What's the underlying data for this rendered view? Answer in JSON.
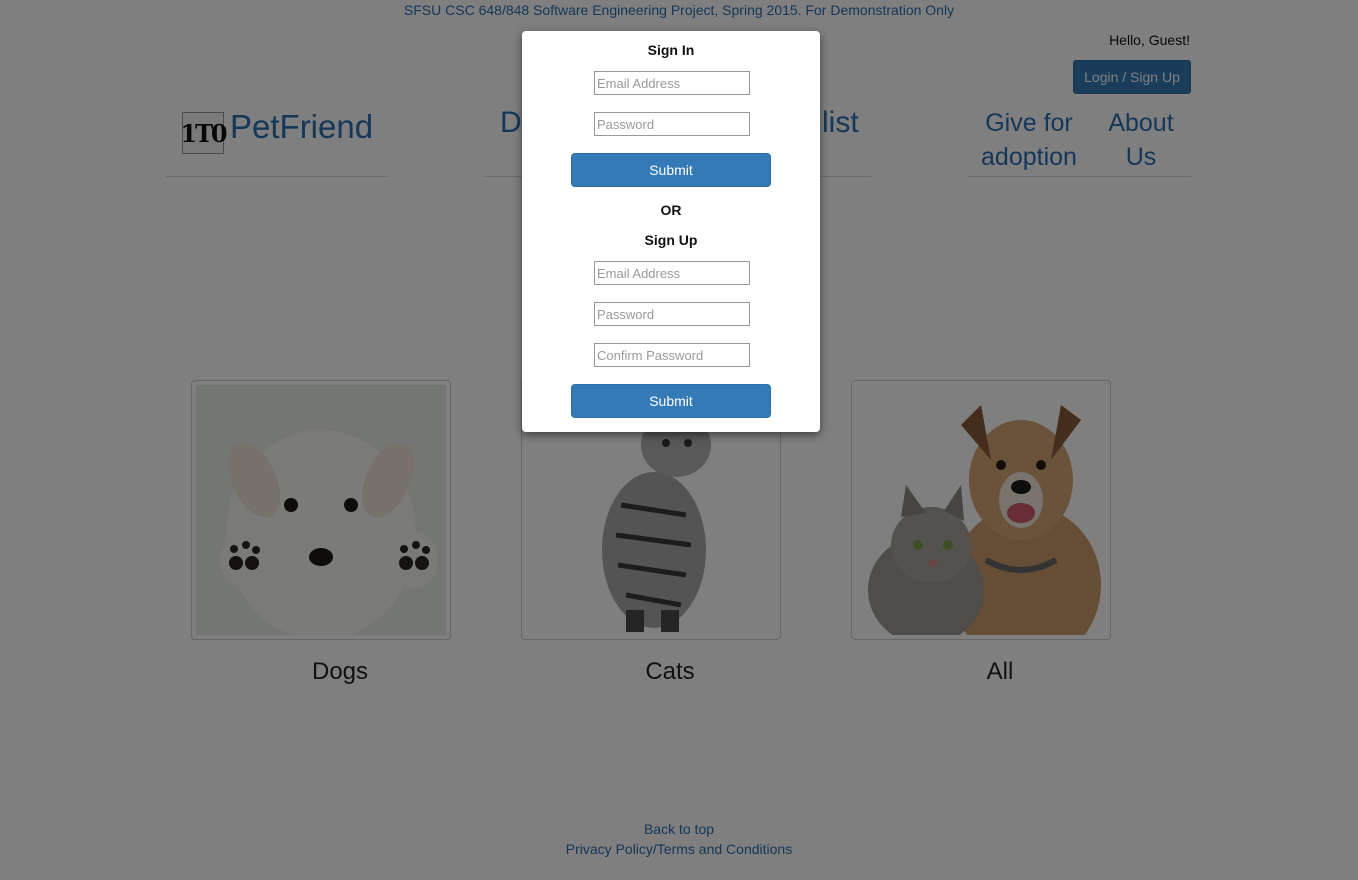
{
  "banner": "SFSU CSC 648/848 Software Engineering Project, Spring 2015. For Demonstration Only",
  "header": {
    "greeting": "Hello, Guest!",
    "login_button": "Login / Sign Up"
  },
  "brand": {
    "logo_text": "1T0",
    "name": "PetFriend"
  },
  "nav": {
    "middle_left_fragment": "D",
    "middle_right_fragment": "list",
    "give_for_adoption_line1": "Give for",
    "give_for_adoption_line2": "adoption",
    "about_line1": "About",
    "about_line2": "Us"
  },
  "categories": [
    {
      "label": "Dogs",
      "icon": "puppy-photo"
    },
    {
      "label": "Cats",
      "icon": "cat-photo"
    },
    {
      "label": "All",
      "icon": "dog-and-cat-photo"
    }
  ],
  "footer": {
    "back_to_top": "Back to top",
    "privacy": "Privacy Policy/Terms and Conditions"
  },
  "modal": {
    "sign_in_title": "Sign In",
    "sign_in_email_placeholder": "Email Address",
    "sign_in_password_placeholder": "Password",
    "sign_in_submit": "Submit",
    "or": "OR",
    "sign_up_title": "Sign Up",
    "sign_up_email_placeholder": "Email Address",
    "sign_up_password_placeholder": "Password",
    "sign_up_confirm_placeholder": "Confirm Password",
    "sign_up_submit": "Submit"
  },
  "colors": {
    "link": "#2a6fb2",
    "primary_button": "#337ab7",
    "overlay": "rgba(0,0,0,0.5)"
  }
}
